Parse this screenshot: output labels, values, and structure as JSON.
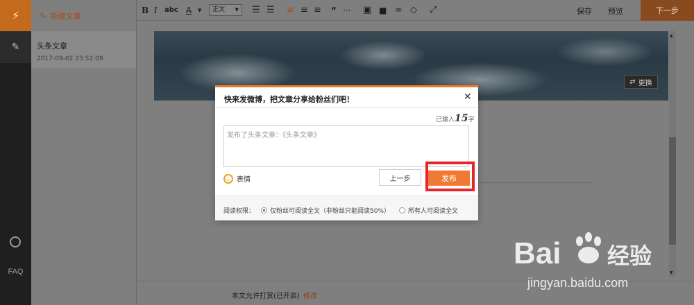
{
  "rail": {
    "top_icon": "lightning-icon",
    "edit_icon": "pencil-icon",
    "stamp_icon": "stamp-icon",
    "faq": "FAQ"
  },
  "list": {
    "new_article": "新建文章",
    "items": [
      {
        "title": "头条文章",
        "time": "2017-09-02 23:52:09"
      }
    ]
  },
  "toolbar": {
    "bold": "B",
    "italic": "I",
    "strike": "abc",
    "font_color": "A",
    "paragraph": "正文",
    "save": "保存",
    "preview": "预览",
    "next": "下一步",
    "icons": [
      "bold-icon",
      "italic-icon",
      "strikethrough-icon",
      "font-color-icon",
      "ordered-list-icon",
      "unordered-list-icon",
      "align-left-icon",
      "align-center-icon",
      "align-right-icon",
      "quote-icon",
      "divider-icon",
      "image-icon",
      "video-icon",
      "link-icon",
      "vote-icon",
      "fullscreen-icon"
    ]
  },
  "cover": {
    "swap_label": "更换"
  },
  "footer": {
    "status": "本文允许打赏(已开启)",
    "edit": "修改"
  },
  "modal": {
    "title": "快来发微博，把文章分享给粉丝们吧！",
    "count_prefix": "已输入",
    "count": "15",
    "count_suffix": "字",
    "input_value": "发布了头条文章：《头条文章》",
    "emoji_label": "表情",
    "prev": "上一步",
    "publish": "发布",
    "perm_label": "阅读权限：",
    "perm_option_1": "仅粉丝可阅读全文（非粉丝只能阅读50%）",
    "perm_option_2": "所有人可阅读全文"
  },
  "watermark": {
    "logo": "Bai经验",
    "url": "jingyan.baidu.com"
  },
  "colors": {
    "accent": "#f07a33",
    "highlight": "#e9232a",
    "brand": "#c46a1c"
  }
}
